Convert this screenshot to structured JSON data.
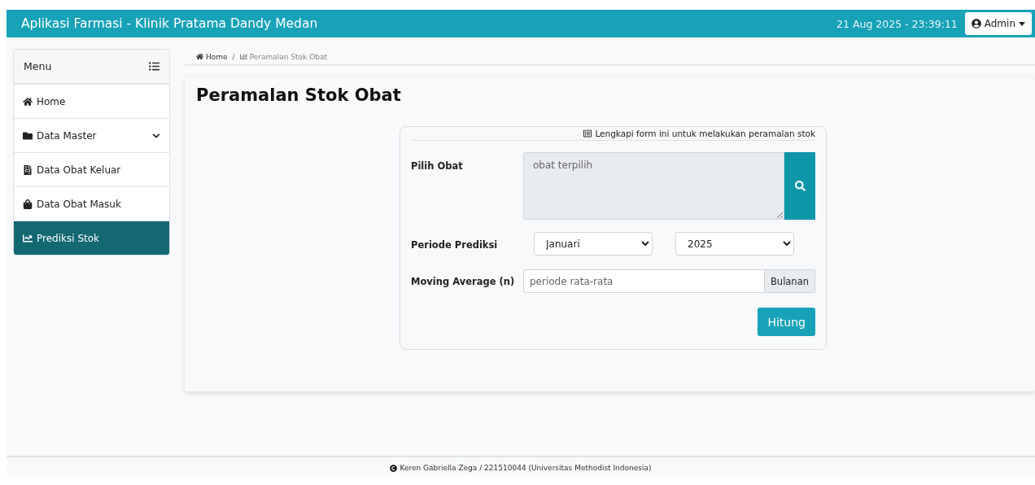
{
  "navbar": {
    "title": "Aplikasi Farmasi - Klinik Pratama Dandy Medan",
    "datetime": "21 Aug 2025 -  23:39:11",
    "user": "Admin"
  },
  "sidebar": {
    "title": "Menu",
    "items": [
      {
        "label": "Home",
        "selected": false
      },
      {
        "label": "Data Master",
        "selected": false,
        "expanded": false
      },
      {
        "label": "Data Obat Keluar",
        "selected": false
      },
      {
        "label": "Data Obat Masuk",
        "selected": false
      },
      {
        "label": "Prediksi Stok",
        "selected": true
      }
    ]
  },
  "breadcrumb": {
    "items": [
      "Home",
      "Peramalan Stok Obat"
    ],
    "separator": "/"
  },
  "page_title": "Peramalan Stok Obat",
  "form": {
    "hint": "Lengkapi form ini untuk melakukan peramalan stok",
    "obat": {
      "label": "Pilih Obat",
      "placeholder": "obat terpilih"
    },
    "periode": {
      "label": "Periode Prediksi",
      "month": "Januari",
      "year": "2025"
    },
    "moving_average": {
      "label": "Moving Average (n)",
      "placeholder": "periode rata-rata",
      "addon": "Bulanan"
    },
    "submit": "Hitung"
  },
  "footer": "Keren Gabriella Zega / 221510044 (Universitas Methodist Indonesia)"
}
